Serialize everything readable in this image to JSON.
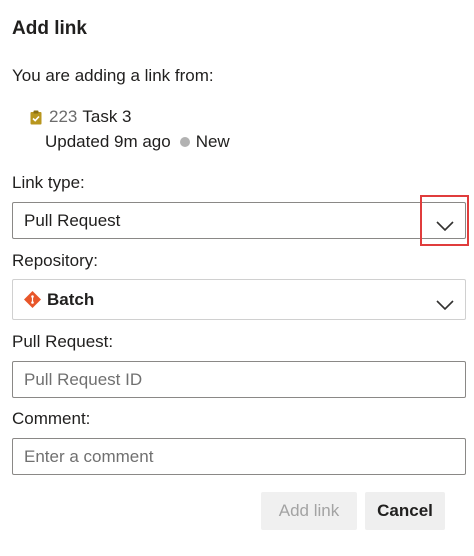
{
  "dialog": {
    "title": "Add link",
    "intro": "You are adding a link from:"
  },
  "work_item": {
    "icon": "task-clipboard-icon",
    "id": "223",
    "title": "Task 3",
    "updated": "Updated 9m ago",
    "state": "New",
    "icon_color": "#b8961e",
    "state_color": "#b2b2b2"
  },
  "link_type": {
    "label": "Link type:",
    "value": "Pull Request"
  },
  "repository": {
    "label": "Repository:",
    "value": "Batch",
    "icon": "git-repo-icon",
    "icon_color": "#e8562a"
  },
  "pull_request": {
    "label": "Pull Request:",
    "placeholder": "Pull Request ID"
  },
  "comment": {
    "label": "Comment:",
    "placeholder": "Enter a comment"
  },
  "buttons": {
    "add": "Add link",
    "cancel": "Cancel"
  },
  "highlight_color": "#e03c3c"
}
